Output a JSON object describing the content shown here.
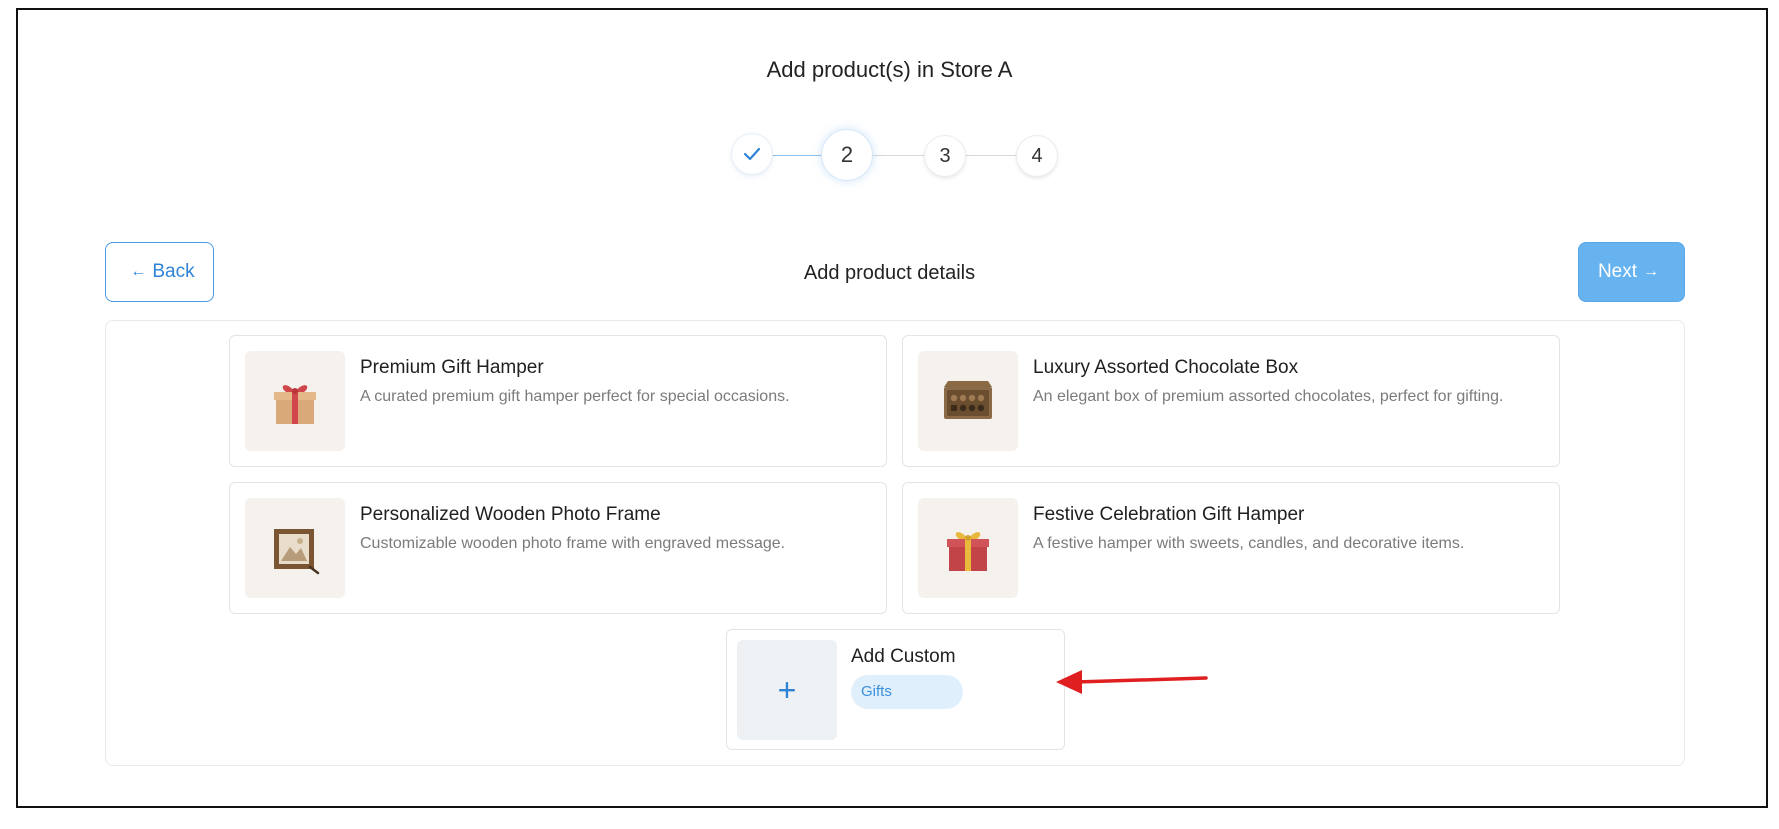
{
  "header": {
    "title": "Add product(s) in Store A"
  },
  "stepper": {
    "steps": [
      {
        "label": "",
        "state": "done",
        "icon": "checkmark-icon"
      },
      {
        "label": "2",
        "state": "current"
      },
      {
        "label": "3",
        "state": "upcoming"
      },
      {
        "label": "4",
        "state": "upcoming"
      }
    ]
  },
  "nav": {
    "back_label": "Back",
    "back_icon": "←",
    "next_label": "Next",
    "next_icon": "→"
  },
  "section": {
    "title": "Add product details"
  },
  "products": [
    {
      "name": "Premium Gift Hamper",
      "description": "A curated premium gift hamper perfect for special occasions.",
      "icon": "gift-box-icon"
    },
    {
      "name": "Luxury Assorted Chocolate Box",
      "description": "An elegant box of premium assorted chocolates, perfect for gifting.",
      "icon": "chocolate-box-icon"
    },
    {
      "name": "Personalized Wooden Photo Frame",
      "description": "Customizable wooden photo frame with engraved message.",
      "icon": "photo-frame-icon"
    },
    {
      "name": "Festive Celebration Gift Hamper",
      "description": "A festive hamper with sweets, candles, and decorative items.",
      "icon": "festive-gift-icon"
    }
  ],
  "custom": {
    "title": "Add Custom",
    "tag": "Gifts",
    "icon_glyph": "+"
  },
  "colors": {
    "accent": "#2f83d6",
    "next_button": "#66b3f0",
    "tag_bg": "#e0effc",
    "annotation_arrow": "#e02020"
  }
}
